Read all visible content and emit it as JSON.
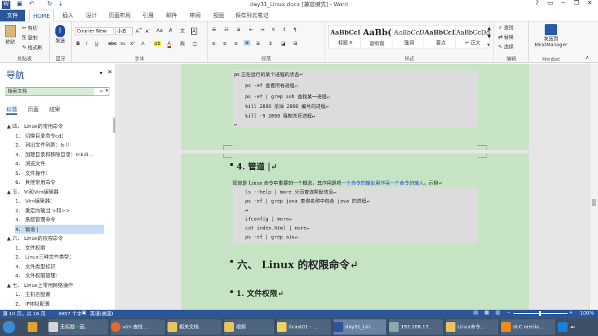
{
  "window": {
    "title": "day31_Linux.docx [兼容模式] - Word",
    "controls": [
      "?",
      "▭",
      "─",
      "❐",
      "✕"
    ]
  },
  "tabs": [
    "文件",
    "HOME",
    "插入",
    "设计",
    "页面布局",
    "引用",
    "邮件",
    "审阅",
    "视图",
    "保存到云笔记"
  ],
  "ribbon": {
    "clipboard": {
      "paste": "粘贴",
      "cut": "剪切",
      "copy": "复制",
      "format_painter": "格式刷",
      "label": "剪贴板"
    },
    "bluetooth": {
      "send": "发送",
      "label": "蓝牙"
    },
    "font": {
      "name": "Courier New",
      "size": "小五",
      "label": "字体"
    },
    "paragraph": {
      "label": "段落"
    },
    "styles": {
      "items": [
        {
          "sample": "AaBbCcI",
          "name": "标题 6"
        },
        {
          "sample": "AaBb(",
          "name": "副标题"
        },
        {
          "sample": "AaBbCcD",
          "name": "强调"
        },
        {
          "sample": "AaBbCcD",
          "name": "要点"
        },
        {
          "sample": "AaBbCcDd",
          "name": "↵ 正文"
        }
      ],
      "label": "样式"
    },
    "editing": {
      "find": "查找",
      "replace": "替换",
      "select": "选择",
      "label": "编辑"
    },
    "mindjet": {
      "send": "发送到",
      "app": "MindManager",
      "label": "Mindjet"
    }
  },
  "nav": {
    "title": "导航",
    "search_placeholder": "搜索文档",
    "tabs": [
      "标题",
      "页面",
      "结果"
    ],
    "items": [
      {
        "text": "▲ 四、 Linux的常用命令",
        "level": 0
      },
      {
        "text": "1． 切换目录命令cd：",
        "level": 1
      },
      {
        "text": "2． 列出文件列表：ls ll",
        "level": 1
      },
      {
        "text": "3． 创建目录和移除目录：mkdi...",
        "level": 1
      },
      {
        "text": "4． 浏览文件",
        "level": 1
      },
      {
        "text": "5． 文件操作：",
        "level": 1
      },
      {
        "text": "6． 其他常用命令",
        "level": 1
      },
      {
        "text": "▲ 五、 Vi和Vim编辑器",
        "level": 0
      },
      {
        "text": "1． Vim编辑器：",
        "level": 1
      },
      {
        "text": "2． 重定向输出 >和>>",
        "level": 1
      },
      {
        "text": "3． 系统管理命令",
        "level": 1
      },
      {
        "text": "4． 管道 |",
        "level": 1,
        "highlight": true
      },
      {
        "text": "▲ 六、 Linux的权限命令",
        "level": 0
      },
      {
        "text": "1． 文件权限",
        "level": 1
      },
      {
        "text": "2． Linux三种文件类型：",
        "level": 1
      },
      {
        "text": "3． 文件类型标识",
        "level": 1
      },
      {
        "text": "4． 文件权限管理：",
        "level": 1
      },
      {
        "text": "▲ 七、 Linux上常用网络操作",
        "level": 0
      },
      {
        "text": "1． 主机名配置",
        "level": 1
      },
      {
        "text": "2． IP地址配置",
        "level": 1
      }
    ]
  },
  "doc": {
    "block1": {
      "lines": [
        "ps 正在运行的某个进程的状态↵",
        "ps -ef  查看所有进程↵",
        "ps -ef | grep ssh 查找某一进程↵",
        "kill 2868  杀掉 2868 编号的进程↵",
        "kill -9 2868  强制杀死进程↵",
        "↵"
      ]
    },
    "heading_pipe": "4.  管道 |↵",
    "para_pipe_pre": "管道是 Linux 命令中重要的一个概念，其作用是将",
    "para_pipe_link": "一个命令的输出用作另一个命令的输入",
    "para_pipe_post": "。示例↵",
    "block2": {
      "lines": [
        "ls --help | more  分页查询帮助信息↵",
        "ps -ef | grep java  查询名称中包含 java 的进程↵",
        "↵",
        "ifconfig | more↵",
        "cat index.html | more↵",
        "ps -ef | grep aio↵"
      ]
    },
    "heading_perm": "六、  Linux 的权限命令↵",
    "heading_file_perm": "1.  文件权限↵"
  },
  "status": {
    "page": "第 10 页，共 16 页",
    "words": "3857 个字",
    "lang": "英语(美国)",
    "zoom": "100%"
  },
  "taskbar": {
    "items": [
      "无标题 - 画...",
      "vim 查找 ...",
      "相关文档",
      "视频",
      "itcast01 - ...",
      "day31_Lin...",
      "192.168.17...",
      "Linux命令...",
      "VLC media..."
    ]
  },
  "colors": {
    "accent": "#2b579a",
    "page_bg": "#c6e4c4",
    "code_bg": "#dcdcdc",
    "link": "#2038c8"
  }
}
